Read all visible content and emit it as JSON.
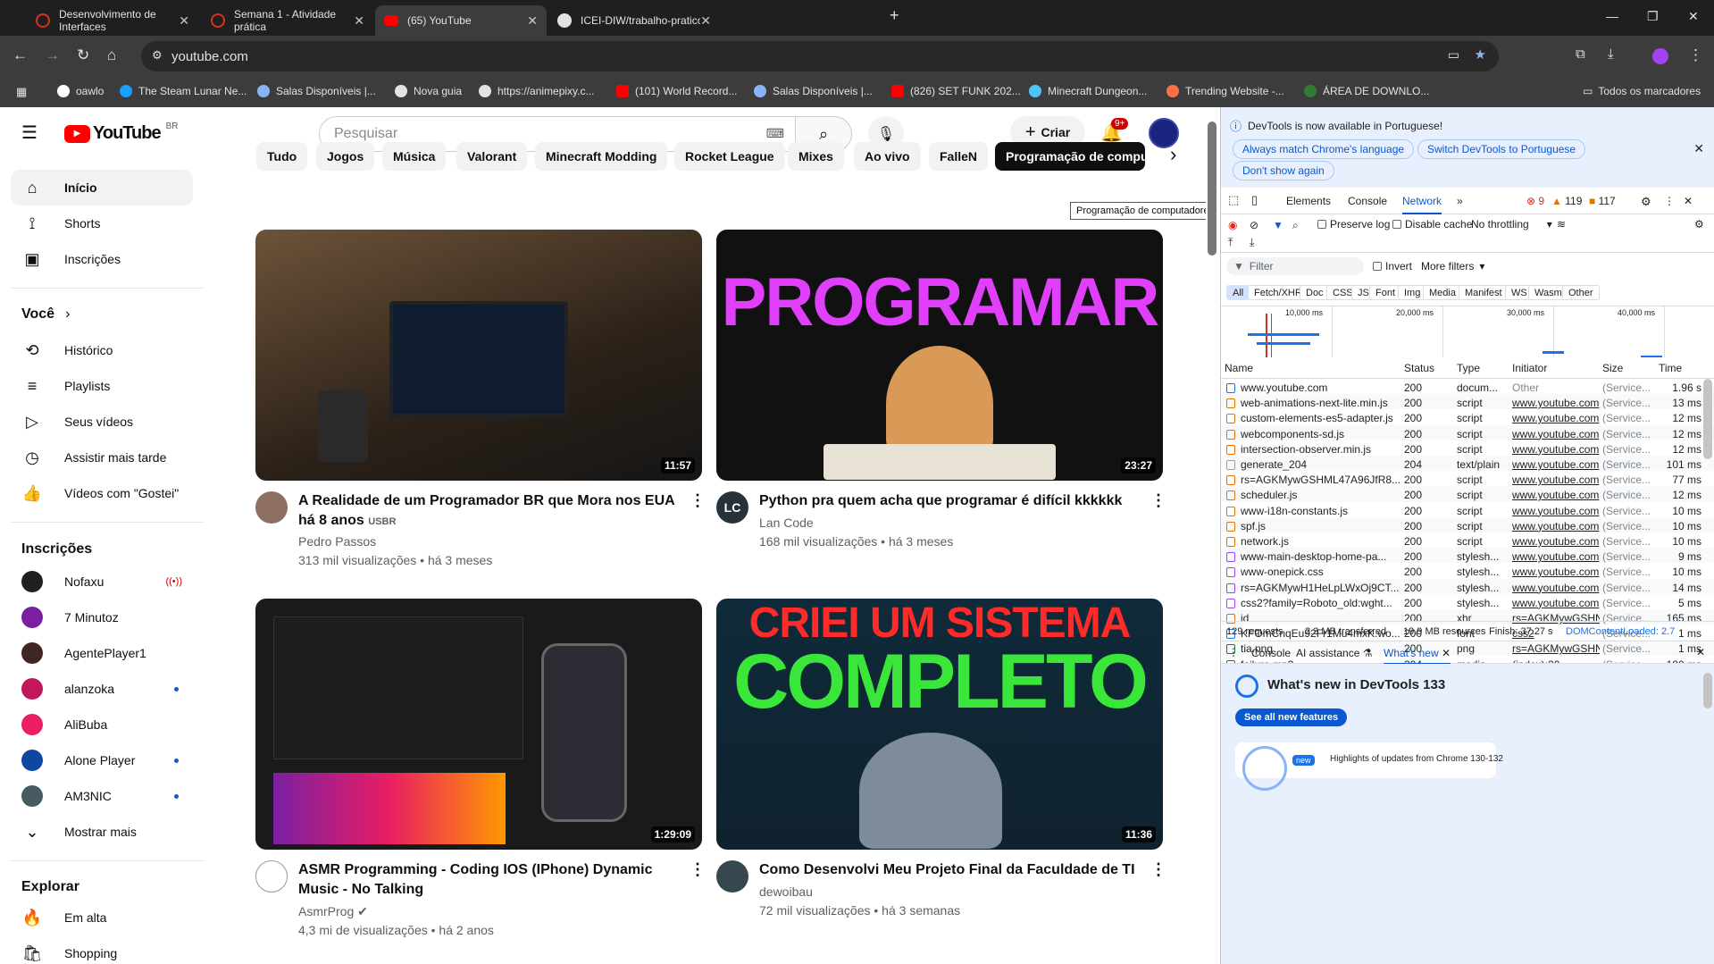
{
  "browser": {
    "tabs": [
      {
        "label": "Desenvolvimento de Interfaces",
        "color": "#d93025"
      },
      {
        "label": "Semana 1 - Atividade prática",
        "color": "#d93025"
      },
      {
        "label": "(65) YouTube",
        "color": "#ff0000"
      },
      {
        "label": "ICEI-DIW/trabalho-pratico-sem",
        "color": "#e3e3e3"
      }
    ],
    "url": "youtube.com",
    "bookmarks": [
      "oawlo",
      "The Steam Lunar Ne...",
      "Salas Disponíveis |...",
      "Nova guia",
      "https://animepixy.c...",
      "(101) World Record...",
      "Salas Disponíveis |...",
      "(826) SET FUNK 202...",
      "Minecraft Dungeon...",
      "Trending Website -...",
      "ÁREA DE DOWNLO..."
    ],
    "all_bookmarks": "Todos os marcadores"
  },
  "youtube": {
    "logo": "YouTube",
    "region": "BR",
    "search_placeholder": "Pesquisar",
    "create": "Criar",
    "notif_count": "9+",
    "sidebar": {
      "main": [
        "Início",
        "Shorts",
        "Inscrições"
      ],
      "you_heading": "Você",
      "you_items": [
        "Histórico",
        "Playlists",
        "Seus vídeos",
        "Assistir mais tarde",
        "Vídeos com \"Gostei\""
      ],
      "subs_heading": "Inscrições",
      "subs": [
        {
          "name": "Nofaxu",
          "live": true,
          "color": "#1f1f1f"
        },
        {
          "name": "7 Minutoz",
          "live": false,
          "color": "#7b1fa2"
        },
        {
          "name": "AgentePlayer1",
          "live": false,
          "color": "#3e2723"
        },
        {
          "name": "alanzoka",
          "live": false,
          "dot": true,
          "color": "#c2185b"
        },
        {
          "name": "AliBuba",
          "live": false,
          "color": "#e91e63"
        },
        {
          "name": "Alone Player",
          "live": false,
          "dot": true,
          "color": "#0d47a1"
        },
        {
          "name": "AM3NIC",
          "live": false,
          "dot": true,
          "color": "#455a64"
        }
      ],
      "show_more": "Mostrar mais",
      "explore_heading": "Explorar",
      "explore": [
        "Em alta",
        "Shopping"
      ]
    },
    "chips": [
      "Tudo",
      "Jogos",
      "Música",
      "Valorant",
      "Minecraft Modding",
      "Rocket League",
      "Mixes",
      "Ao vivo",
      "FalleN",
      "Programação de comput"
    ],
    "tooltip": "Programação de computadores",
    "videos": [
      {
        "title": "A Realidade de um Programador BR que Mora nos EUA há 8 anos",
        "tag": "USBR",
        "channel": "Pedro Passos",
        "meta": "313 mil visualizações • há 3 meses",
        "duration": "11:57",
        "thumb": "#3b2f25"
      },
      {
        "title": "Python pra quem acha que programar é difícil kkkkkk",
        "channel": "Lan Code",
        "avatar": "LC",
        "meta": "168 mil visualizações • há 3 meses",
        "duration": "23:27",
        "thumb": "#111111",
        "overlay": "PROGRAMAR"
      },
      {
        "title": "ASMR Programming - Coding IOS (IPhone) Dynamic Music - No Talking",
        "channel": "AsmrProg",
        "meta": "4,3 mi de visualizações • há 2 anos",
        "duration": "1:29:09",
        "thumb": "#1a1a1a"
      },
      {
        "title": "Como Desenvolvi Meu Projeto Final da Faculdade de TI",
        "channel": "dewoibau",
        "meta": "72 mil visualizações • há 3 semanas",
        "duration": "11:36",
        "thumb": "#0f2a3a",
        "overlay1": "CRIEI UM SISTEMA",
        "overlay2": "COMPLETO"
      }
    ]
  },
  "devtools": {
    "banner": "DevTools is now available in Portuguese!",
    "btn1": "Always match Chrome's language",
    "btn2": "Switch DevTools to Portuguese",
    "btn3": "Don't show again",
    "tabs": [
      "Elements",
      "Console",
      "Network"
    ],
    "errors": "9",
    "warnings": "119",
    "issues": "117",
    "preserve_log": "Preserve log",
    "disable_cache": "Disable cache",
    "throttling": "No throttling",
    "filter_placeholder": "Filter",
    "invert": "Invert",
    "more_filters": "More filters",
    "types": [
      "All",
      "Fetch/XHR",
      "Doc",
      "CSS",
      "JS",
      "Font",
      "Img",
      "Media",
      "Manifest",
      "WS",
      "Wasm",
      "Other"
    ],
    "timeline": [
      "10,000 ms",
      "20,000 ms",
      "30,000 ms",
      "40,000 ms"
    ],
    "columns": [
      "Name",
      "Status",
      "Type",
      "Initiator",
      "Size",
      "Time"
    ],
    "rows": [
      [
        "www.youtube.com",
        "200",
        "docum...",
        "Other",
        "(Service...",
        "1.96 s"
      ],
      [
        "web-animations-next-lite.min.js",
        "200",
        "script",
        "www.youtube.com",
        "(Service...",
        "13 ms"
      ],
      [
        "custom-elements-es5-adapter.js",
        "200",
        "script",
        "www.youtube.com",
        "(Service...",
        "12 ms"
      ],
      [
        "webcomponents-sd.js",
        "200",
        "script",
        "www.youtube.com",
        "(Service...",
        "12 ms"
      ],
      [
        "intersection-observer.min.js",
        "200",
        "script",
        "www.youtube.com",
        "(Service...",
        "12 ms"
      ],
      [
        "generate_204",
        "204",
        "text/plain",
        "www.youtube.com",
        "(Service...",
        "101 ms"
      ],
      [
        "rs=AGKMywGSHML47A96JfR8...",
        "200",
        "script",
        "www.youtube.com",
        "(Service...",
        "77 ms"
      ],
      [
        "scheduler.js",
        "200",
        "script",
        "www.youtube.com",
        "(Service...",
        "12 ms"
      ],
      [
        "www-i18n-constants.js",
        "200",
        "script",
        "www.youtube.com",
        "(Service...",
        "10 ms"
      ],
      [
        "spf.js",
        "200",
        "script",
        "www.youtube.com",
        "(Service...",
        "10 ms"
      ],
      [
        "network.js",
        "200",
        "script",
        "www.youtube.com",
        "(Service...",
        "10 ms"
      ],
      [
        "www-main-desktop-home-pa...",
        "200",
        "stylesh...",
        "www.youtube.com",
        "(Service...",
        "9 ms"
      ],
      [
        "www-onepick.css",
        "200",
        "stylesh...",
        "www.youtube.com",
        "(Service...",
        "10 ms"
      ],
      [
        "rs=AGKMywH1HeLpLWxOj9CT...",
        "200",
        "stylesh...",
        "www.youtube.com",
        "(Service...",
        "14 ms"
      ],
      [
        "css2?family=Roboto_old:wght...",
        "200",
        "stylesh...",
        "www.youtube.com",
        "(Service...",
        "5 ms"
      ],
      [
        "id",
        "200",
        "xhr",
        "rs=AGKMywGSHN",
        "(Service...",
        "165 ms"
      ],
      [
        "KFOmCnqEu92Fr1Mu4mxK.wo...",
        "200",
        "font",
        "css2",
        "(Service...",
        "1 ms"
      ],
      [
        "tia.png",
        "200",
        "png",
        "rs=AGKMywGSHN",
        "(Service...",
        "1 ms"
      ],
      [
        "failure.mp3",
        "304",
        "media",
        "(index):20",
        "(Service...",
        "190 ms"
      ]
    ],
    "status": {
      "requests": "129 requests",
      "transferred": "2.3 MB transferred",
      "resources": "19.9 MB resources",
      "finish": "Finish: 37.27 s",
      "dcl": "DOMContentLoaded: 2.7"
    },
    "drawer_tabs": [
      "Console",
      "AI assistance",
      "What's new"
    ],
    "whatsnew_title": "What's new in DevTools 133",
    "see_all": "See all new features",
    "highlights": "Highlights of updates from Chrome 130-132",
    "new_badge": "new"
  }
}
